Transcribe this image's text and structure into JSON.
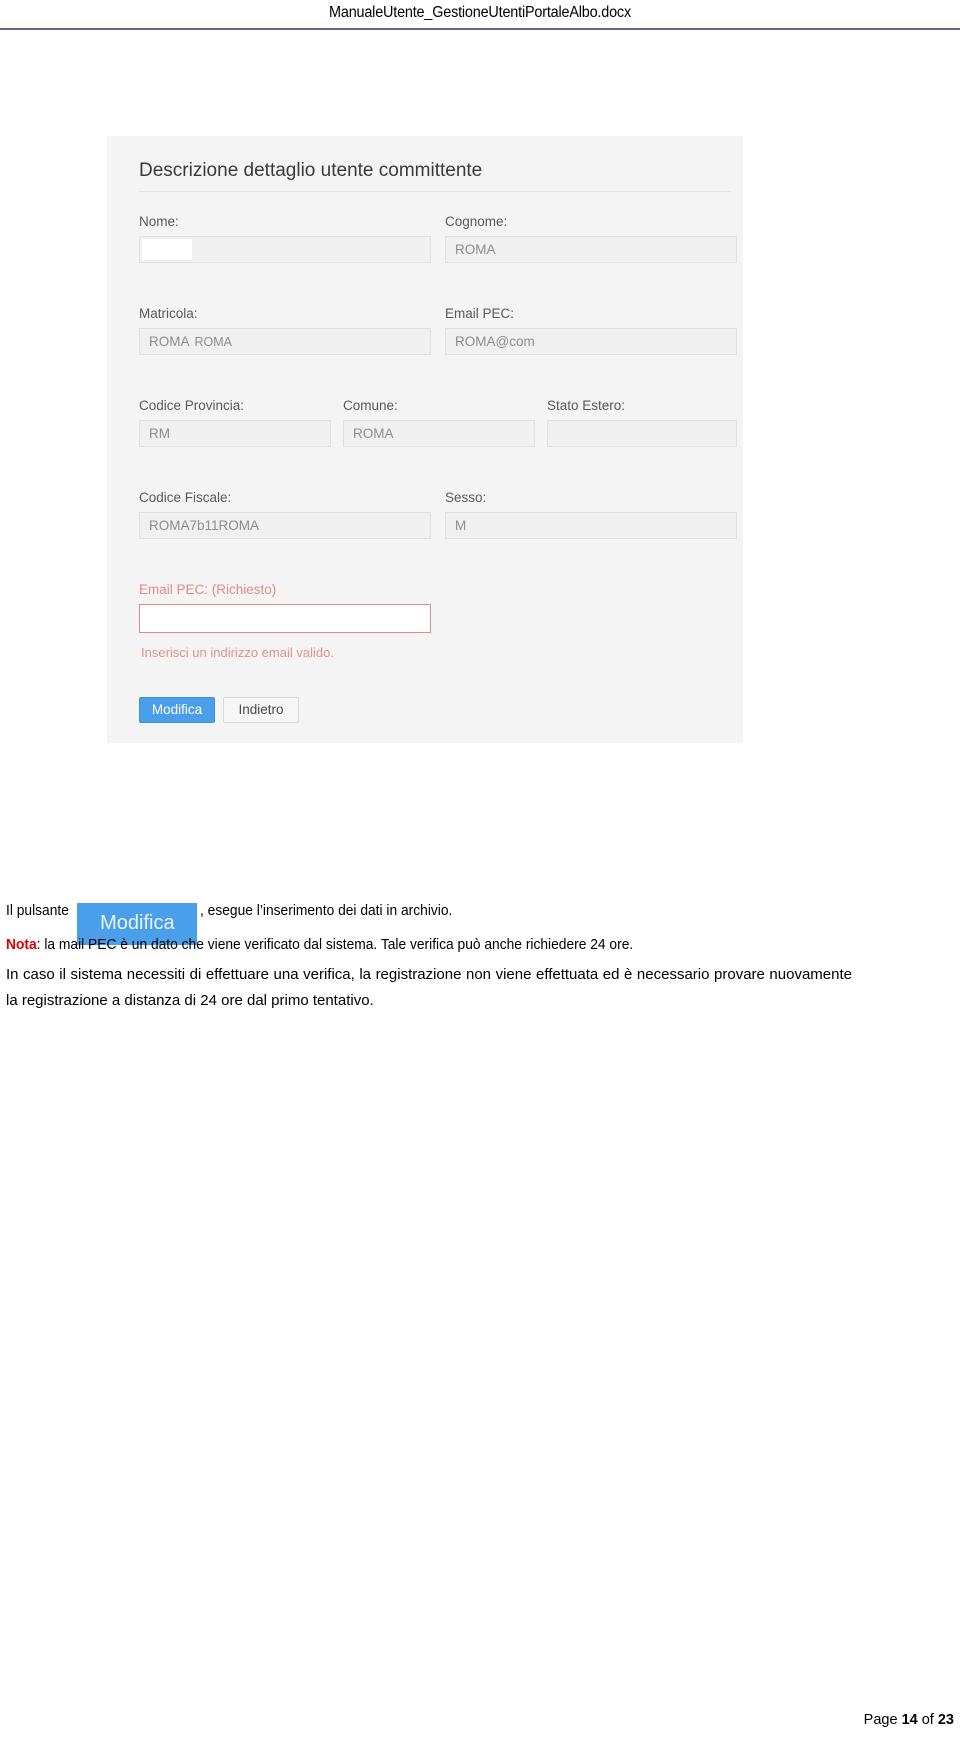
{
  "document": {
    "header_title": "ManualeUtente_GestioneUtentiPortaleAlbo.docx",
    "footer": {
      "prefix": "Page ",
      "page_number": "14",
      "middle": " of ",
      "total_pages": "23"
    }
  },
  "screenshot": {
    "panel_title": "Descrizione dettaglio utente committente",
    "fields": [
      {
        "label": "Nome:",
        "value": ""
      },
      {
        "label": "Cognome:",
        "value": "ROMA"
      },
      {
        "label": "Matricola:",
        "value": "ROMA",
        "value_suffix": "ROMA"
      },
      {
        "label": "Email PEC:",
        "value": "ROMA@com"
      },
      {
        "label": "Codice Provincia:",
        "value": "RM"
      },
      {
        "label": "Comune:",
        "value": "ROMA"
      },
      {
        "label": "Stato Estero:",
        "value": ""
      },
      {
        "label": "Codice Fiscale:",
        "value": "ROMA7b11ROMA"
      },
      {
        "label": "Sesso:",
        "value": "M"
      }
    ],
    "required_field": {
      "label": "Email PEC: (Richiesto)",
      "value": "",
      "error_message": "Inserisci un indirizzo email valido."
    },
    "buttons": {
      "primary": "Modifica",
      "secondary": "Indietro"
    },
    "colors": {
      "primary_button": "#4a9eea",
      "error": "#e08c85",
      "field_background": "#f0f0f0",
      "panel_background": "#f4f4f4"
    }
  },
  "body": {
    "pulsante_prefix": "Il pulsante",
    "inline_button_label": "Modifica",
    "pulsante_suffix": ", esegue l’inserimento dei dati in archivio.",
    "nota_keyword": "Nota",
    "nota_text": ": la mail PEC è un dato che viene verificato dal sistema. Tale verifica può anche richiedere 24 ore.",
    "paragraph_tail": "In caso il sistema necessiti di effettuare una verifica, la registrazione non viene effettuata ed è necessario provare nuovamente la registrazione a distanza di 24 ore dal primo tentativo.",
    "nota_color": "#e00000"
  }
}
